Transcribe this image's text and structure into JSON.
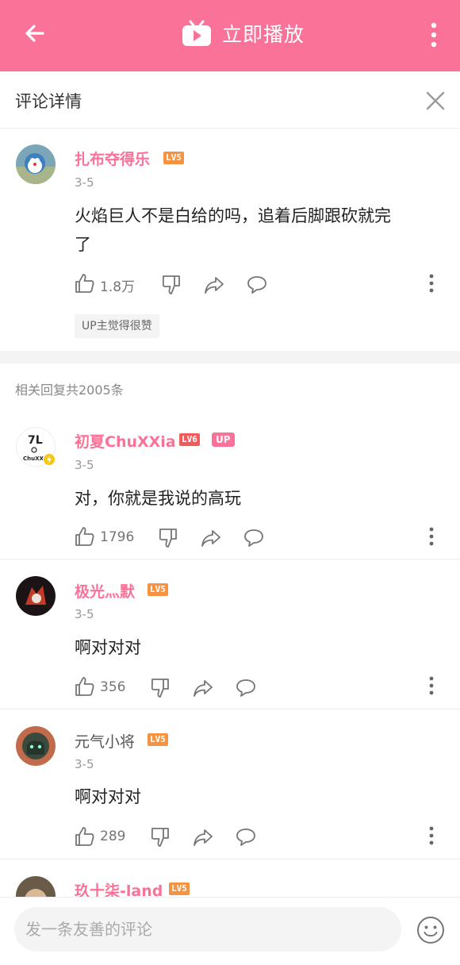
{
  "topbar": {
    "title": "立即播放",
    "back_icon": "arrow-back-icon",
    "play_icon": "tv-icon",
    "more_icon": "more-vertical-icon",
    "color": "#fb7299"
  },
  "detail": {
    "label": "评论详情"
  },
  "main_comment": {
    "username": "扎布夺得乐",
    "level": "LV5",
    "time": "3-5",
    "content_line1": "火焰巨人不是白给的吗，追着后脚跟砍就完",
    "content_line2": "了",
    "likes": "1.8万",
    "badge": "UP主觉得很赞"
  },
  "replies_count_text": "相关回复共2005条",
  "replies": [
    {
      "username": "初夏ChuXXia",
      "level": "LV6",
      "up_tag": "UP",
      "time": "3-5",
      "content": "对，你就是我说的高玩",
      "likes": "1796"
    },
    {
      "username": "极光灬默",
      "level": "LV5",
      "time": "3-5",
      "content": "啊对对对",
      "likes": "356"
    },
    {
      "username": "元气小将",
      "level": "LV5",
      "time": "3-5",
      "content": "啊对对对",
      "likes": "289"
    },
    {
      "username": "玖十柒-land",
      "level": "LV5"
    }
  ],
  "bottom": {
    "placeholder": "发一条友善的评论",
    "emoji_icon": "emoji-icon"
  }
}
